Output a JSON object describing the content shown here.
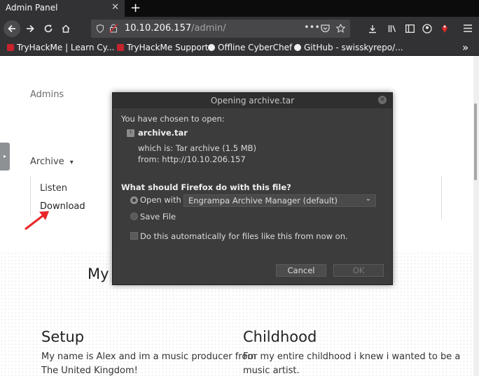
{
  "browser": {
    "tab_title": "Admin Panel",
    "tab_close": "✕",
    "new_tab": "+",
    "url_host": "10.10.206.157",
    "url_path": "/admin/",
    "url_actions": "•••",
    "bookmarks": [
      {
        "label": "TryHackMe | Learn Cy...",
        "color": "#c8232c"
      },
      {
        "label": "TryHackMe Support",
        "color": "#c8232c"
      },
      {
        "label": "Offline CyberChef",
        "color": "#f0f0f0"
      },
      {
        "label": "GitHub - swisskyrepo/...",
        "color": "#f0f0f0"
      }
    ],
    "bookmarks_overflow": "»"
  },
  "page": {
    "admins_label": "Admins",
    "archive_label": "Archive",
    "archive_caret": "▾",
    "menu_items": [
      "Listen",
      "Download"
    ],
    "heading_partial": "My",
    "sections": [
      {
        "title": "Setup",
        "text_lines": [
          "My name is Alex and im a music producer from",
          "The United Kingdom!"
        ]
      },
      {
        "title": "Childhood",
        "text_lines": [
          "For my entire childhood i knew i wanted to be a",
          "music artist."
        ]
      }
    ]
  },
  "dialog": {
    "title": "Opening archive.tar",
    "intro": "You have chosen to open:",
    "file_name": "archive.tar",
    "which_is": "which is: Tar archive (1.5 MB)",
    "from": "from: http://10.10.206.157",
    "question": "What should Firefox do with this file?",
    "open_with_label": "Open with",
    "open_with_value": "Engrampa Archive Manager (default)",
    "save_file_label": "Save File",
    "auto_label": "Do this automatically for files like this from now on.",
    "cancel_label": "Cancel",
    "ok_label": "OK",
    "selected_option": "open_with"
  },
  "colors": {
    "annotation_arrow": "#e8262a",
    "dialog_bg": "#3c3c3c"
  }
}
